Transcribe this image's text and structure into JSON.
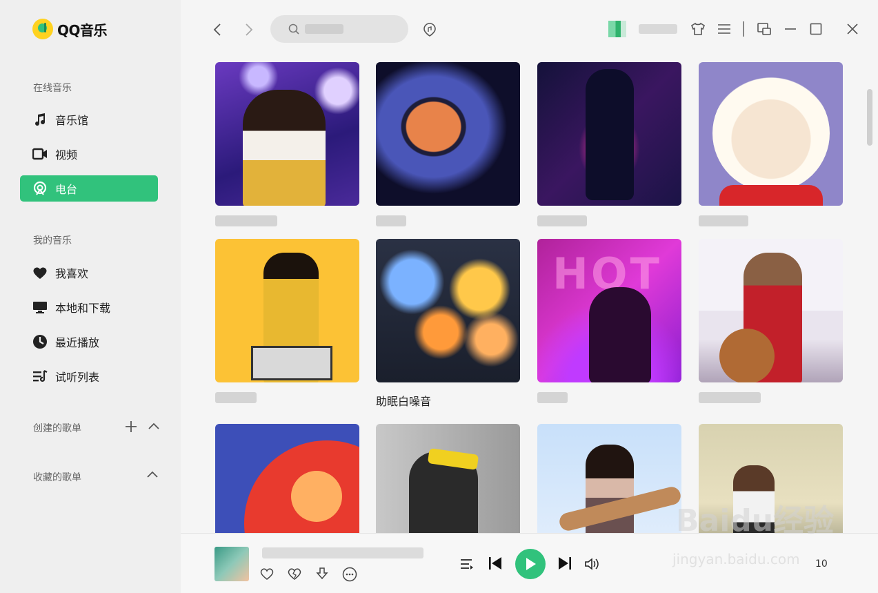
{
  "app": {
    "name": "QQ音乐"
  },
  "sidebar": {
    "online_title": "在线音乐",
    "online_items": [
      {
        "label": "音乐馆",
        "icon": "music-note-icon"
      },
      {
        "label": "视频",
        "icon": "video-icon"
      },
      {
        "label": "电台",
        "icon": "radio-icon",
        "active": true
      }
    ],
    "mine_title": "我的音乐",
    "mine_items": [
      {
        "label": "我喜欢",
        "icon": "heart-icon"
      },
      {
        "label": "本地和下载",
        "icon": "monitor-icon"
      },
      {
        "label": "最近播放",
        "icon": "clock-icon"
      },
      {
        "label": "试听列表",
        "icon": "playlist-icon"
      }
    ],
    "created_title": "创建的歌单",
    "collected_title": "收藏的歌单"
  },
  "topbar": {
    "search_placeholder": "搜",
    "user_name": ""
  },
  "grid": {
    "cards": [
      {
        "label": ""
      },
      {
        "label": ""
      },
      {
        "label": ""
      },
      {
        "label": ""
      },
      {
        "label": ""
      },
      {
        "label": "助眠白噪音"
      },
      {
        "label": ""
      },
      {
        "label": ""
      },
      {
        "label": ""
      },
      {
        "label": ""
      },
      {
        "label": ""
      },
      {
        "label": ""
      }
    ]
  },
  "player": {
    "song_title": "",
    "volume_count": "10"
  },
  "watermark": {
    "brand": "Baidu经验",
    "url": "jingyan.baidu.com"
  },
  "colors": {
    "accent": "#31c27c",
    "sidebar_bg": "#efefef",
    "content_bg": "#f5f5f5"
  }
}
